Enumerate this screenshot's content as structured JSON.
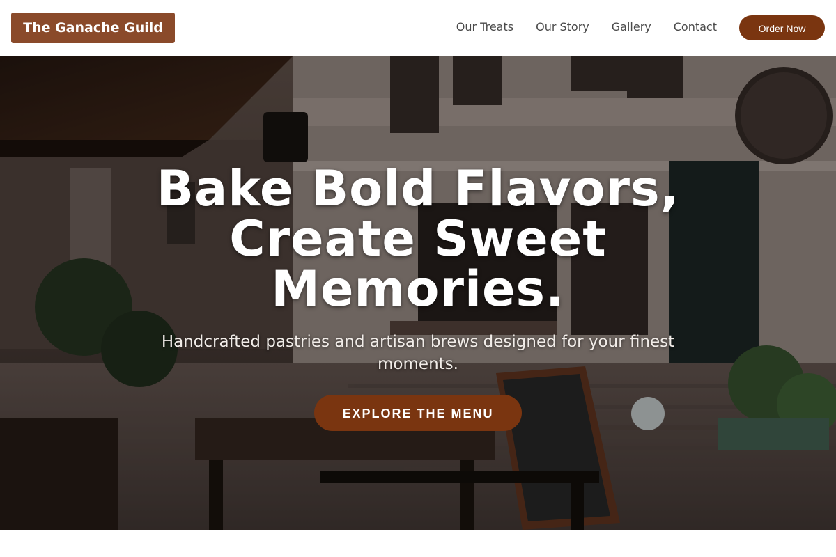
{
  "header": {
    "brand": "The Ganache Guild",
    "nav": [
      {
        "label": "Our Treats"
      },
      {
        "label": "Our Story"
      },
      {
        "label": "Gallery"
      },
      {
        "label": "Contact"
      }
    ],
    "order_button": "Order Now"
  },
  "hero": {
    "title_line1": "Bake Bold Flavors,",
    "title_line2": "Create Sweet",
    "title_line3": "Memories.",
    "subtitle": "Handcrafted pastries and artisan brews designed for your finest moments.",
    "cta": "EXPLORE THE MENU"
  },
  "colors": {
    "brand_bg": "#8a4a2a",
    "accent": "#7a3510",
    "nav_text": "#4a4a4a"
  }
}
